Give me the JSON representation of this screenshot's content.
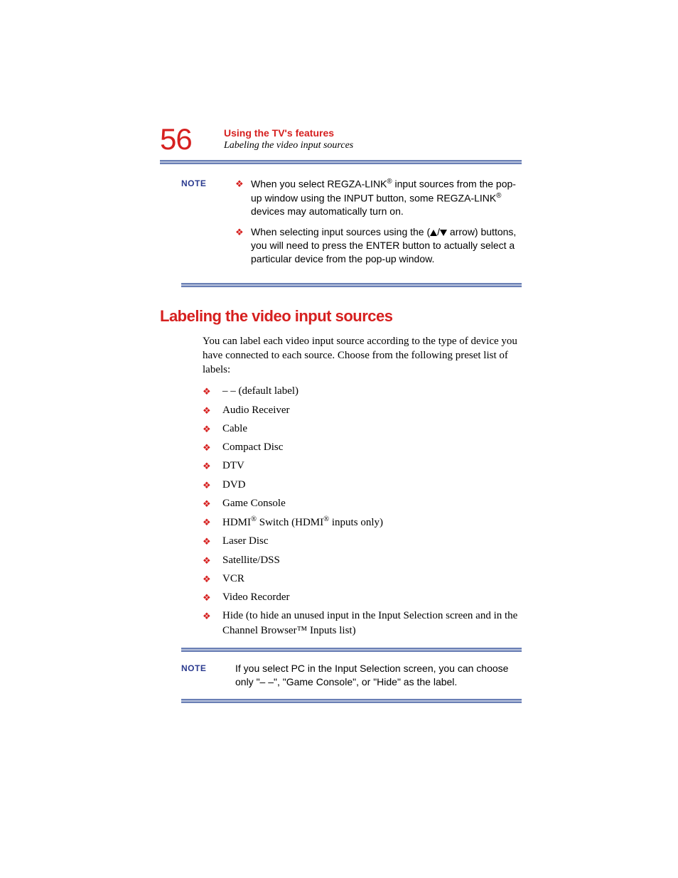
{
  "page_number": "56",
  "chapter_title": "Using the TV's features",
  "section_subtitle": "Labeling the video input sources",
  "note_label": "NOTE",
  "note1": {
    "bullets": [
      {
        "pre": "When you select REGZA-LINK",
        "sup1": "®",
        "mid": " input sources from the pop-up window using the INPUT button, some REGZA-LINK",
        "sup2": "®",
        "post": " devices may automatically turn on."
      },
      {
        "pre": "When selecting input sources using the (",
        "mid": " arrow) buttons, you will need to press the ENTER button to actually select a particular device from the pop-up window."
      }
    ]
  },
  "section_heading": "Labeling the video input sources",
  "intro_text": "You can label each video input source according to the type of device you have connected to each source. Choose from the following preset list of labels:",
  "labels": [
    {
      "text": "– – (default label)"
    },
    {
      "text": "Audio Receiver"
    },
    {
      "text": "Cable"
    },
    {
      "text": "Compact Disc"
    },
    {
      "text": "DTV"
    },
    {
      "text": "DVD"
    },
    {
      "text": "Game Console"
    },
    {
      "pre": "HDMI",
      "sup1": "®",
      "mid": " Switch (HDMI",
      "sup2": "®",
      "post": " inputs only)"
    },
    {
      "text": "Laser Disc"
    },
    {
      "text": "Satellite/DSS"
    },
    {
      "text": "VCR"
    },
    {
      "text": "Video Recorder"
    },
    {
      "text": "Hide (to hide an unused input in the Input Selection screen and in the Channel Browser™ Inputs list)"
    }
  ],
  "note2_text": "If you select PC in the Input Selection screen, you can choose only \"– –\", \"Game Console\", or \"Hide\" as the label."
}
